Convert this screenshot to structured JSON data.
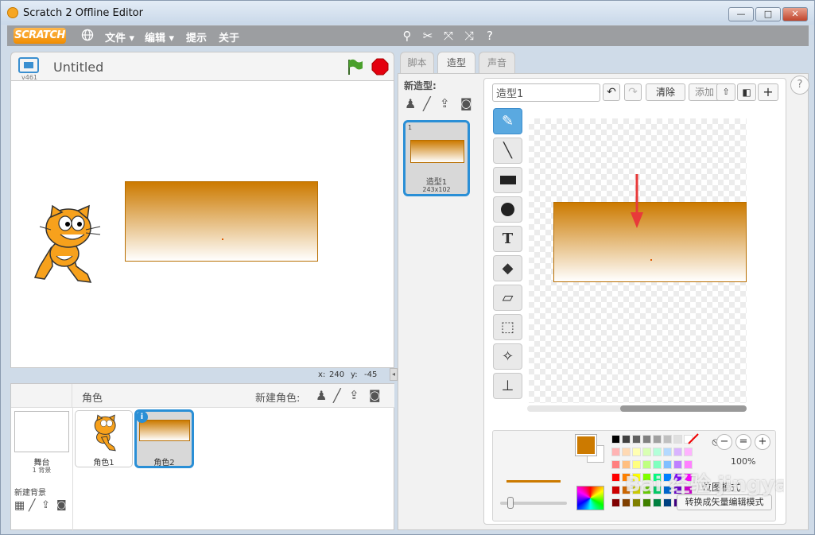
{
  "window": {
    "title": "Scratch 2 Offline Editor",
    "minimize": "—",
    "maximize": "□",
    "close": "✕"
  },
  "menubar": {
    "logo": "SCRATCH",
    "file": "文件 ▾",
    "edit": "编辑 ▾",
    "tips": "提示",
    "about": "关于"
  },
  "stage_header": {
    "version": "v461",
    "project_title": "Untitled"
  },
  "stage_info": {
    "x_label": "x:",
    "x_value": "240",
    "y_label": "y:",
    "y_value": "-45"
  },
  "sprites": {
    "header": "角色",
    "new_sprite": "新建角色:",
    "stage_label": "舞台",
    "stage_sub": "1 背景",
    "new_backdrop": "新建背景",
    "items": [
      {
        "name": "角色1"
      },
      {
        "name": "角色2",
        "info": "i"
      }
    ]
  },
  "tabs": [
    {
      "label": "脚本"
    },
    {
      "label": "造型"
    },
    {
      "label": "声音"
    }
  ],
  "costumes": {
    "header": "新造型:",
    "items": [
      {
        "index": "1",
        "name": "造型1",
        "size": "243x102"
      }
    ]
  },
  "paint_editor": {
    "costume_name": "造型1",
    "clear": "清除",
    "add": "添加",
    "zoom": "100%",
    "bitmap_mode": "位图模式",
    "convert_vector": "转换成矢量编辑模式",
    "fill_color": "#cc7a00",
    "tools": [
      "brush-icon",
      "line-icon",
      "rectangle-icon",
      "ellipse-icon",
      "text-icon",
      "fill-icon",
      "eraser-icon",
      "select-icon",
      "magic-wand-icon",
      "stamp-icon"
    ]
  },
  "palette": [
    "#000000",
    "#404040",
    "#606060",
    "#808080",
    "#a0a0a0",
    "#c0c0c0",
    "#e0e0e0",
    "#ffffff",
    "#ffb3b3",
    "#ffd9b3",
    "#ffffb3",
    "#d9ffb3",
    "#b3ffd9",
    "#b3d9ff",
    "#d9b3ff",
    "#ffb3ff",
    "#ff8080",
    "#ffbf80",
    "#ffff80",
    "#bfff80",
    "#80ffbf",
    "#80bfff",
    "#bf80ff",
    "#ff80ff",
    "#ff0000",
    "#ff8000",
    "#ffff00",
    "#80ff00",
    "#00ff80",
    "#0080ff",
    "#8000ff",
    "#ff00ff",
    "#cc0000",
    "#cc6600",
    "#cccc00",
    "#66cc00",
    "#00cc66",
    "#0066cc",
    "#6600cc",
    "#cc00cc",
    "#800000",
    "#804000",
    "#808000",
    "#408000",
    "#008040",
    "#004080",
    "#400080",
    "#800080"
  ],
  "watermark": "Bai 经验 jingyan.baidu.com"
}
